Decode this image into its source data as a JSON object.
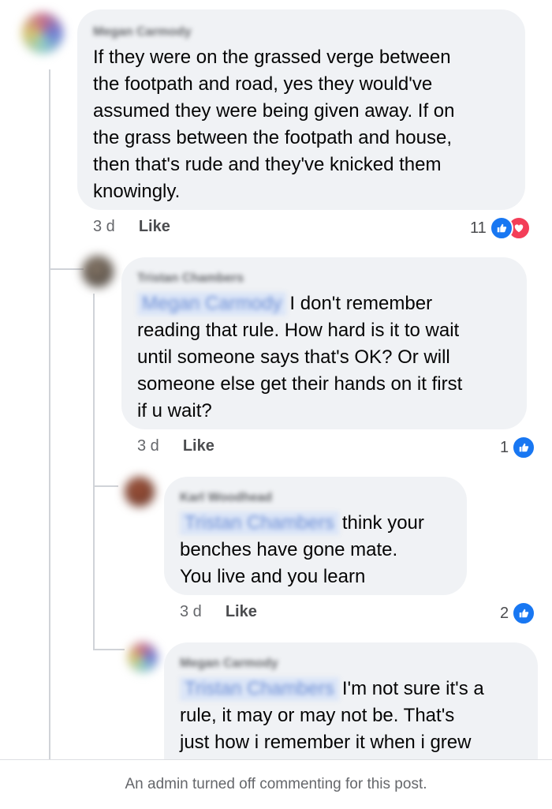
{
  "comments": [
    {
      "author": "Megan Carmody",
      "mention": "",
      "text": "If they were on the grassed verge between\nthe footpath and road, yes they would've\nassumed they were being given away. If on\nthe grass between the footpath and house,\nthen that's rude and they've knicked them\nknowingly.",
      "time": "3 d",
      "like_label": "Like",
      "reaction_count": "11",
      "reactions": [
        "like-icon",
        "love-icon"
      ]
    },
    {
      "author": "Tristan Chambers",
      "mention": "Megan Carmody",
      "text": "I don't remember\nreading that rule. How hard is it to wait\nuntil someone says that's OK? Or will\nsomeone else get their hands on it first\nif u wait?",
      "time": "3 d",
      "like_label": "Like",
      "reaction_count": "1",
      "reactions": [
        "like-icon"
      ]
    },
    {
      "author": "Karl Woodhead",
      "mention": "Tristan Chambers",
      "text": "think your\nbenches have gone mate.\nYou live and you learn",
      "time": "3 d",
      "like_label": "Like",
      "reaction_count": "2",
      "reactions": [
        "like-icon"
      ]
    },
    {
      "author": "Megan Carmody",
      "mention": "Tristan Chambers",
      "text": "I'm not sure it's a\nrule, it may or may not be. That's\njust how i remember it when i grew",
      "time": "",
      "like_label": "",
      "reaction_count": "",
      "reactions": []
    }
  ],
  "footer": {
    "notice": "An admin turned off commenting for this post."
  },
  "colors": {
    "bubble": "#f0f2f5",
    "like_blue": "#1877f2",
    "love_red": "#f33e58",
    "meta_gray": "#65676b"
  }
}
